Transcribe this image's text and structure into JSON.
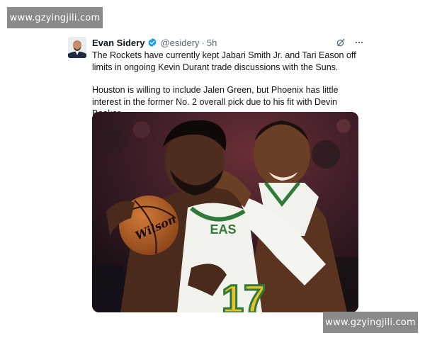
{
  "watermark_top": "www.gzyingjili.com",
  "watermark_bottom": "www.gzyingjili.com",
  "tweet": {
    "author_name": "Evan Sidery",
    "handle": "@esidery",
    "separator": "·",
    "timestamp": "5h",
    "verified": true,
    "paragraphs": [
      "The Rockets have currently kept Jabari Smith Jr. and Tari Eason off limits in ongoing Kevin Durant trade discussions with the Suns.",
      "Houston is willing to include Jalen Green, but Phoenix has little interest in the former No. 2 overall pick due to his fit with Devin Booker."
    ],
    "icons": [
      "verified-badge-icon",
      "grok-icon",
      "more-options-icon"
    ],
    "photo": {
      "jersey_number": "17",
      "jersey_lettering": "EAS",
      "ball_brand": "Wilson"
    }
  },
  "colors": {
    "verified": "#1d9bf0",
    "secondary_text": "#536471",
    "jersey_green": "#2f7a3a",
    "jersey_gold": "#e8c229"
  }
}
